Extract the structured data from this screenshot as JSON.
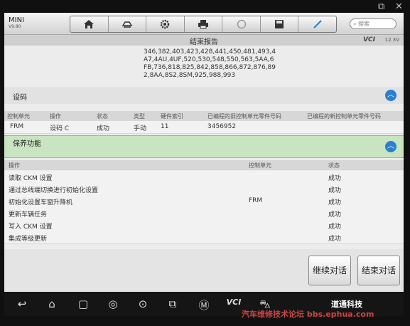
{
  "header": {
    "brand": "MINI",
    "version": "V9.80",
    "search_placeholder": "搜索"
  },
  "title_bar": {
    "title": "结束报告",
    "vci": "VCI",
    "voltage": "12.3V"
  },
  "codes_text": [
    "346,382,403,423,428,441,450,481,493,4",
    "A7,4AU,4UF,520,530,548,550,563,5AA,6",
    "FB,736,818,825,842,858,866,872,876,89",
    "2,8AA,8S2,8SM,925,988,993"
  ],
  "coding": {
    "section_label": "设码",
    "headers": [
      "控制单元",
      "操作",
      "状态",
      "类型",
      "硬件索引",
      "已编程的旧控制单元零件号码",
      "已编程的新控制单元零件号码"
    ],
    "row": [
      "FRM",
      "设码 C",
      "成功",
      "手动",
      "11",
      "3456952",
      ""
    ]
  },
  "maintenance": {
    "section_label": "保养功能",
    "headers": [
      "操作",
      "控制单元",
      "状态"
    ],
    "rows": [
      [
        "读取 CKM 设置",
        "",
        "成功"
      ],
      [
        "通过总线端切换进行初始化设置",
        "",
        "成功"
      ],
      [
        "初始化设置车窗升降机",
        "FRM",
        "成功"
      ],
      [
        "更新车辆任务",
        "",
        "成功"
      ],
      [
        "写入 CKM 设置",
        "",
        "成功"
      ],
      [
        "集成等级更新",
        "",
        "成功"
      ]
    ]
  },
  "actions": {
    "continue": "继续对话",
    "end": "结束对话"
  },
  "watermark": {
    "brand": "道通科技",
    "forum": "汽车维修技术论坛 bbs.ephua.com"
  },
  "colors": {
    "accent": "#2a7fd0",
    "section_green": "#c9e4c0"
  }
}
